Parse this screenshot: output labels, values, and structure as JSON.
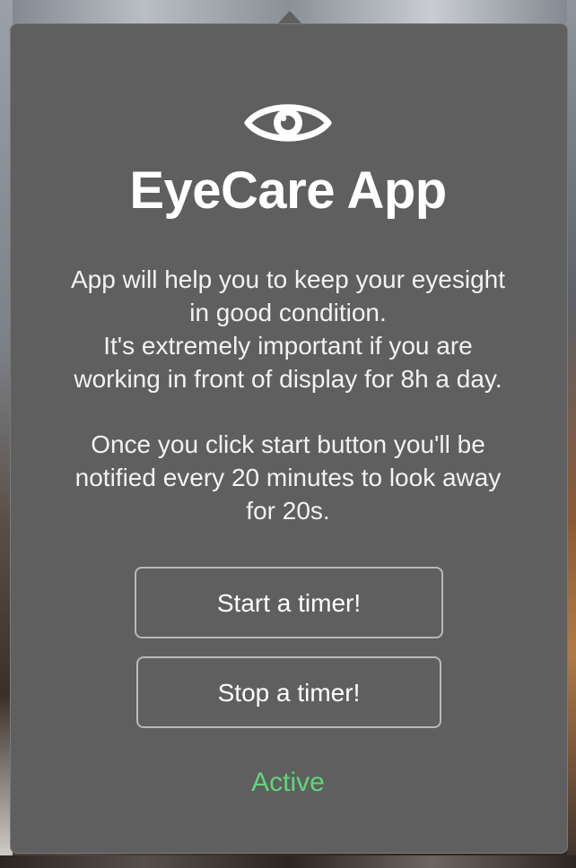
{
  "app": {
    "title": "EyeCare App",
    "icon": "eye-icon"
  },
  "description": {
    "paragraph1": [
      "App will help you to keep your eyesight",
      "in good condition.",
      "It's extremely important if you are",
      "working in front of display for 8h a day."
    ],
    "paragraph2": [
      "Once you click start button you'll be",
      "notified every 20 minutes to look away",
      "for 20s."
    ]
  },
  "buttons": {
    "start_label": "Start a timer!",
    "stop_label": "Stop a timer!"
  },
  "status": {
    "text": "Active",
    "color": "#5fd67a"
  },
  "colors": {
    "panel_background": "#5f5f5f",
    "text": "#ffffff",
    "button_border": "#b9b9b9"
  }
}
